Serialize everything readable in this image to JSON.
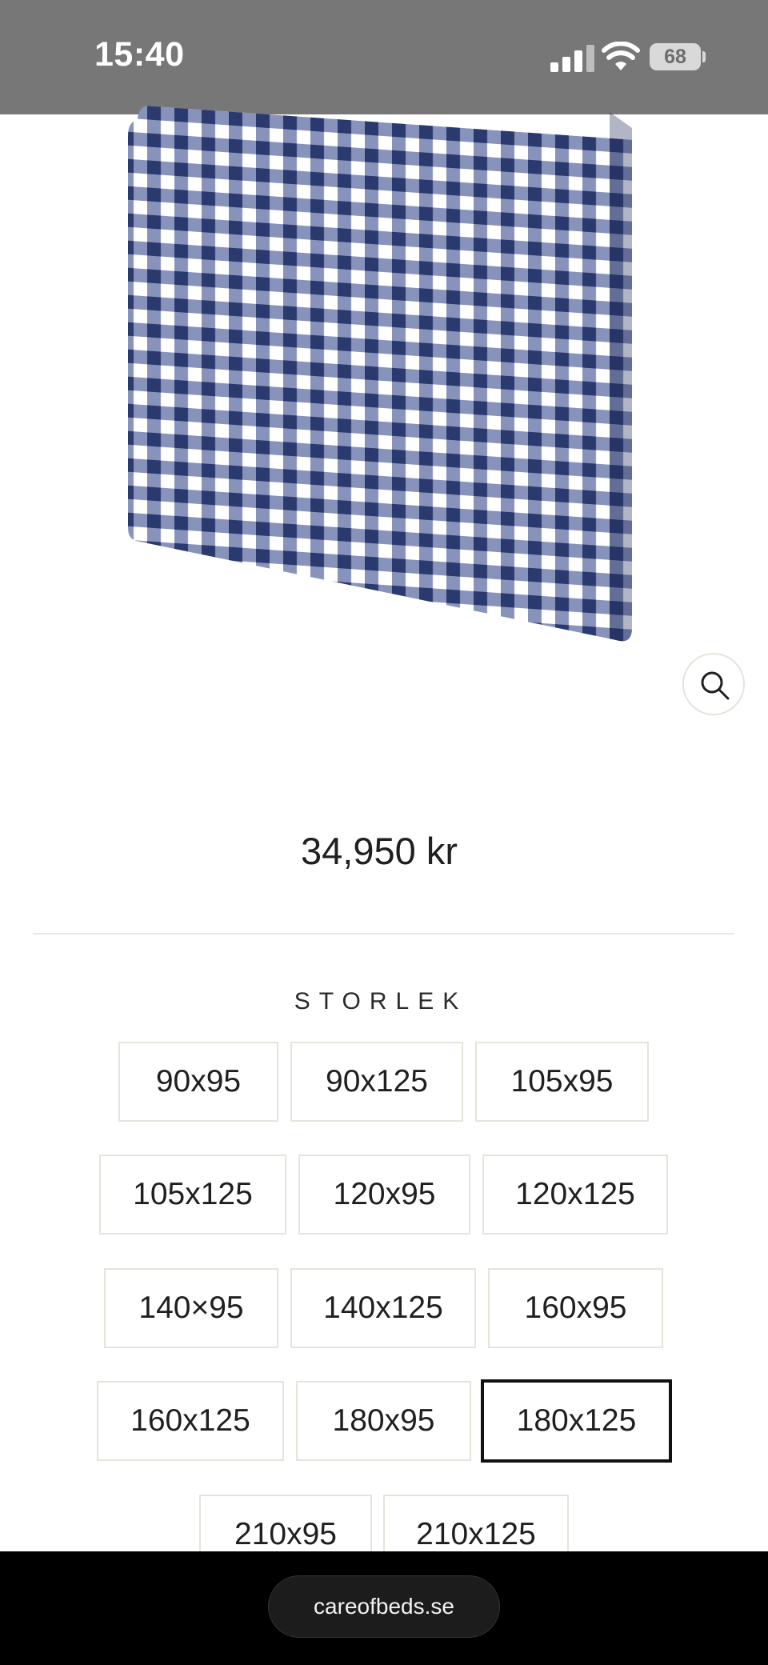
{
  "status_bar": {
    "time": "15:40",
    "battery": "68",
    "icons": [
      "signal-icon",
      "wifi-icon",
      "battery-icon"
    ]
  },
  "product": {
    "image": "blue-white-gingham-headboard",
    "price": "34,950 kr",
    "zoom_icon": "search-icon"
  },
  "size": {
    "heading": "STORLEK",
    "options": [
      "90x95",
      "90x125",
      "105x95",
      "105x125",
      "120x95",
      "120x125",
      "140×95",
      "140x125",
      "160x95",
      "160x125",
      "180x95",
      "180x125",
      "210x95",
      "210x125"
    ],
    "selected": "180x125"
  },
  "browser": {
    "url": "careofbeds.se"
  },
  "colors": {
    "status_bar": "#777777",
    "gingham_dark": "#2b3a6e",
    "gingham_mid": "#7b88b4",
    "selected_border": "#111111"
  }
}
